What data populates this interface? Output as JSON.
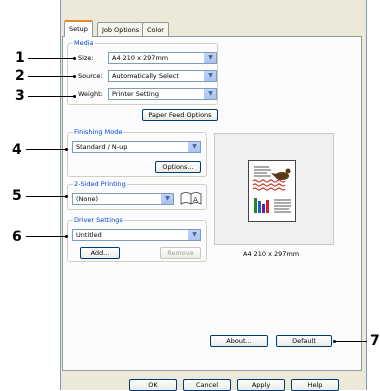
{
  "tabs": [
    {
      "label": "Setup"
    },
    {
      "label": "Job Options"
    },
    {
      "label": "Color"
    }
  ],
  "media": {
    "title": "Media",
    "size_label": "Size:",
    "size_value": "A4 210 x 297mm",
    "source_label": "Source:",
    "source_value": "Automatically Select",
    "weight_label": "Weight:",
    "weight_value": "Printer Setting",
    "paper_feed_button": "Paper Feed Options"
  },
  "finishing": {
    "title": "Finishing Mode",
    "value": "Standard / N-up",
    "options_button": "Options..."
  },
  "two_sided": {
    "title": "2-Sided Printing",
    "value": "(None)"
  },
  "driver": {
    "title": "Driver Settings",
    "value": "Untitled",
    "add_button": "Add...",
    "remove_button": "Remove"
  },
  "preview": {
    "caption": "A4 210 x 297mm"
  },
  "about_button": "About...",
  "default_button": "Default",
  "footer": {
    "ok": "OK",
    "cancel": "Cancel",
    "apply": "Apply",
    "help": "Help"
  },
  "callouts": [
    "1",
    "2",
    "3",
    "4",
    "5",
    "6",
    "7"
  ],
  "colors": {
    "accent_tab": "#e68b2c",
    "group_title": "#0046d5",
    "dialog_bg": "#ece9d8",
    "panel_bg": "#fcfcfe"
  }
}
